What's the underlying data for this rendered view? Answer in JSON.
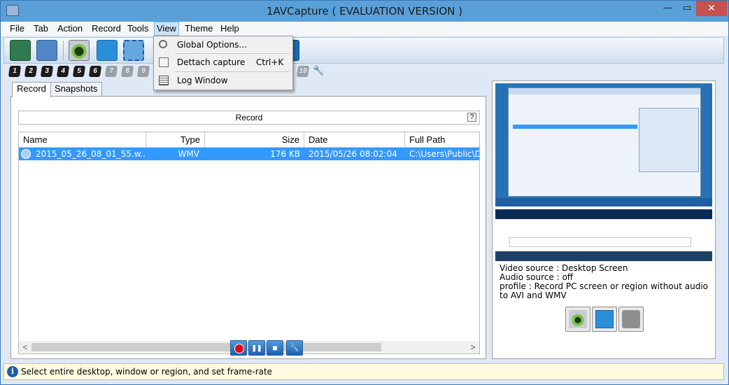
{
  "window": {
    "title": "1AVCapture ( EVALUATION VERSION )",
    "minimize_glyph": "—",
    "maximize_glyph": "▭",
    "close_glyph": "✕"
  },
  "menubar": {
    "items": [
      "File",
      "Tab",
      "Action",
      "Record",
      "Tools",
      "View",
      "Theme",
      "Help"
    ],
    "active": "View"
  },
  "toolbar": {
    "numbers": [
      "1",
      "2",
      "3",
      "4",
      "5",
      "6",
      "7",
      "8",
      "9",
      "19"
    ],
    "wrench_glyph": "🔧"
  },
  "view_menu": {
    "items": [
      {
        "label": "Global Options...",
        "accel_letter": "G",
        "shortcut": ""
      },
      {
        "label": "Dettach capture",
        "accel_letter": "D",
        "shortcut": "Ctrl+K"
      },
      {
        "label": "Log Window",
        "accel_letter": "L",
        "shortcut": ""
      }
    ]
  },
  "tabs": [
    "Record",
    "Snapshots"
  ],
  "record_panel": {
    "header": "Record",
    "help_glyph": "?",
    "columns": [
      "Name",
      "Type",
      "Size",
      "Date",
      "Full Path"
    ],
    "rows": [
      {
        "name": "2015_05_26_08_01_55.w...",
        "type": "WMV",
        "size": "176 KB",
        "date": "2015/05/26 08:02:04",
        "full_path": "C:\\Users\\Public\\D"
      }
    ],
    "scroll_left": "<",
    "scroll_right": ">"
  },
  "controls": {
    "pause_glyph": "❚❚",
    "stop_glyph": "■",
    "settings_glyph": "🔧"
  },
  "info": {
    "video_source": "Video source : Desktop Screen",
    "audio_source": "Audio source : off",
    "profile": "profile : Record PC screen or region without audio to AVI and WMV"
  },
  "status": {
    "icon_glyph": "i",
    "text": "Select entire desktop, window or region, and set frame-rate"
  },
  "colors": {
    "accent": "#3399ff",
    "titlebar": "#5aa0d8",
    "record": "#e0001b"
  }
}
